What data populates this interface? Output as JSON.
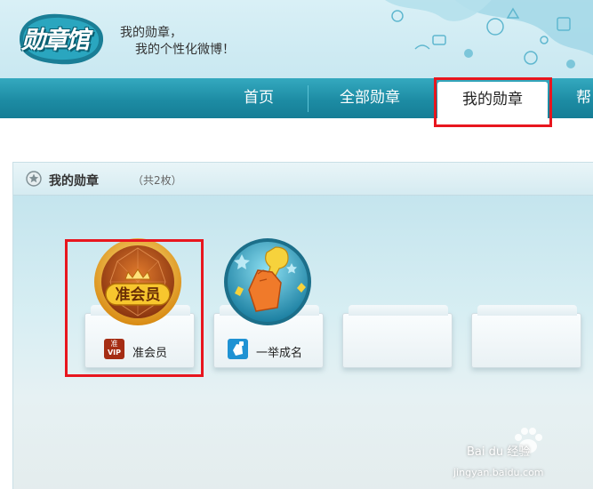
{
  "header": {
    "logo_text": "勋章馆",
    "slogan_line1": "我的勋章，",
    "slogan_line2": "我的个性化微博！"
  },
  "nav": {
    "items": [
      {
        "label": "首页"
      },
      {
        "label": "全部勋章"
      },
      {
        "label": "我的勋章",
        "active": true
      },
      {
        "label": "帮"
      }
    ]
  },
  "panel": {
    "title": "我的勋章",
    "count": "（共2枚）"
  },
  "badges": [
    {
      "name": "准会员",
      "icon": "vip-icon",
      "badge_text": "准会员",
      "small_icon_text_top": "准",
      "small_icon_text_bottom": "VIP"
    },
    {
      "name": "一举成名",
      "icon": "trophy-hand-icon"
    },
    {
      "name": "",
      "icon": "empty-slot"
    },
    {
      "name": "",
      "icon": "empty-slot"
    }
  ],
  "watermark": {
    "brand": "Bai du 经验",
    "url": "jingyan.baidu.com"
  },
  "colors": {
    "nav_bg": "#1d8ca4",
    "highlight_box": "#e8161e",
    "header_bg": "#d9f0f6"
  }
}
